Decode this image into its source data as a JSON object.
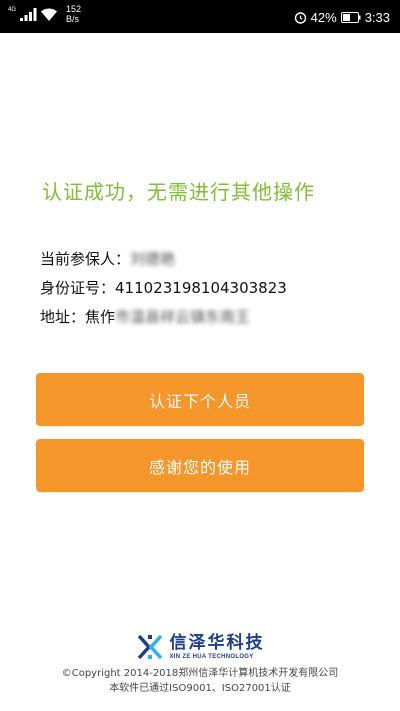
{
  "status_bar": {
    "network_type": "4G",
    "speed_value": "152",
    "speed_unit": "B/s",
    "battery_percent": "42%",
    "time": "3:33",
    "icons": [
      "signal-icon",
      "wifi-icon",
      "alarm-icon",
      "battery-icon"
    ]
  },
  "main": {
    "title": "认证成功，无需进行其他操作",
    "title_color": "#7fbf32",
    "info": {
      "insured_label": "当前参保人：",
      "insured_value": "刘德艳",
      "id_label": "身份证号：",
      "id_value": "411023198104303823",
      "address_label": "地址：",
      "address_prefix": "焦作",
      "address_value": "市温县祥云镇东南王"
    },
    "buttons": {
      "next_person": "认证下个人员",
      "thanks": "感谢您的使用"
    },
    "button_color": "#f5962a"
  },
  "footer": {
    "logo_cn": "信泽华科技",
    "logo_en": "XIN ZE HUA TECHNOLOGY",
    "copyright_line1": "©Copyright 2014-2018郑州信泽华计算机技术开发有限公司",
    "copyright_line2": "本软件已通过ISO9001、ISO27001认证",
    "brand_color": "#1b3e8f"
  }
}
